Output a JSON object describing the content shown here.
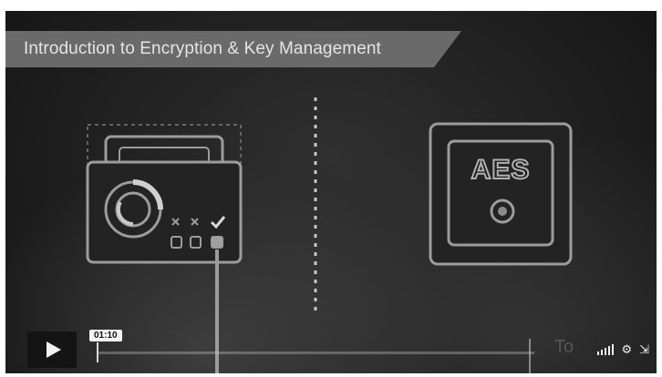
{
  "video": {
    "title": "Introduction to Encryption & Key Management",
    "scene_label": "AES",
    "watermark": "To"
  },
  "controls": {
    "current_time": "01:10",
    "progress_fraction": 0.0,
    "play_icon": "play-icon",
    "volume_icon": "volume-icon",
    "settings_icon": "gear-icon",
    "fullscreen_icon": "fullscreen-icon"
  },
  "colors": {
    "background": "#1b1b1b",
    "banner": "#6a6a6a",
    "line_art": "#a8a8a8"
  }
}
